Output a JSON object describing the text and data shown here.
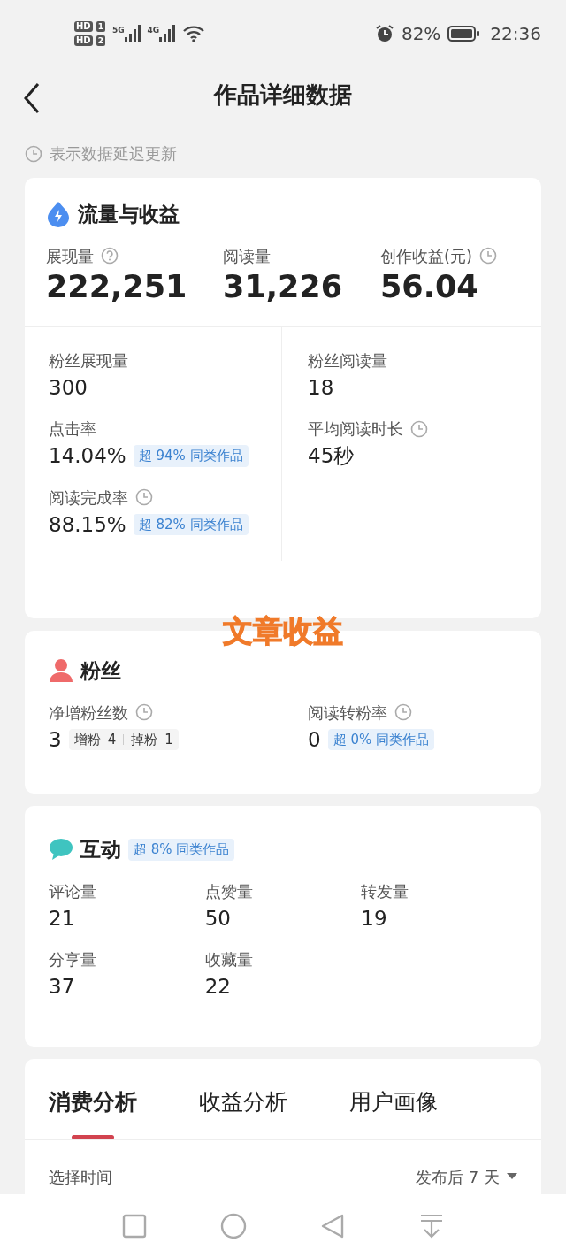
{
  "status_bar": {
    "sims": [
      {
        "label": "HD",
        "slot": "1"
      },
      {
        "label": "HD",
        "slot": "2"
      }
    ],
    "networks": [
      "5G",
      "4G"
    ],
    "battery": "82%",
    "time": "22:36"
  },
  "header": {
    "title": "作品详细数据"
  },
  "notice": "表示数据延迟更新",
  "traffic": {
    "title": "流量与收益",
    "top_metrics": [
      {
        "label": "展现量",
        "value": "222,251",
        "help": true,
        "delayed": false
      },
      {
        "label": "阅读量",
        "value": "31,226",
        "help": false,
        "delayed": false
      },
      {
        "label": "创作收益(元)",
        "value": "56.04",
        "help": false,
        "delayed": true
      }
    ],
    "left_metrics": [
      {
        "label": "粉丝展现量",
        "value": "300",
        "delayed": false
      },
      {
        "label": "点击率",
        "value": "14.04%",
        "delayed": false,
        "badge": "超 94% 同类作品"
      },
      {
        "label": "阅读完成率",
        "value": "88.15%",
        "delayed": true,
        "badge": "超 82% 同类作品"
      }
    ],
    "right_metrics": [
      {
        "label": "粉丝阅读量",
        "value": "18",
        "delayed": false
      },
      {
        "label": "平均阅读时长",
        "value": "45秒",
        "delayed": true
      }
    ]
  },
  "overlay_caption": "文章收益",
  "fans": {
    "title": "粉丝",
    "net_gain": {
      "label": "净增粉丝数",
      "value": "3",
      "delayed": true,
      "details": [
        {
          "label": "增粉",
          "value": "4"
        },
        {
          "label": "掉粉",
          "value": "1"
        }
      ]
    },
    "conversion": {
      "label": "阅读转粉率",
      "value": "0",
      "delayed": true,
      "badge": "超 0% 同类作品"
    }
  },
  "interaction": {
    "title": "互动",
    "badge": "超 8% 同类作品",
    "metrics": [
      {
        "label": "评论量",
        "value": "21"
      },
      {
        "label": "点赞量",
        "value": "50"
      },
      {
        "label": "转发量",
        "value": "19"
      },
      {
        "label": "分享量",
        "value": "37"
      },
      {
        "label": "收藏量",
        "value": "22"
      }
    ]
  },
  "analysis": {
    "tabs": [
      {
        "label": "消费分析",
        "selected": true
      },
      {
        "label": "收益分析",
        "selected": false
      },
      {
        "label": "用户画像",
        "selected": false
      }
    ],
    "time_label": "选择时间",
    "time_value": "发布后 7 天"
  }
}
